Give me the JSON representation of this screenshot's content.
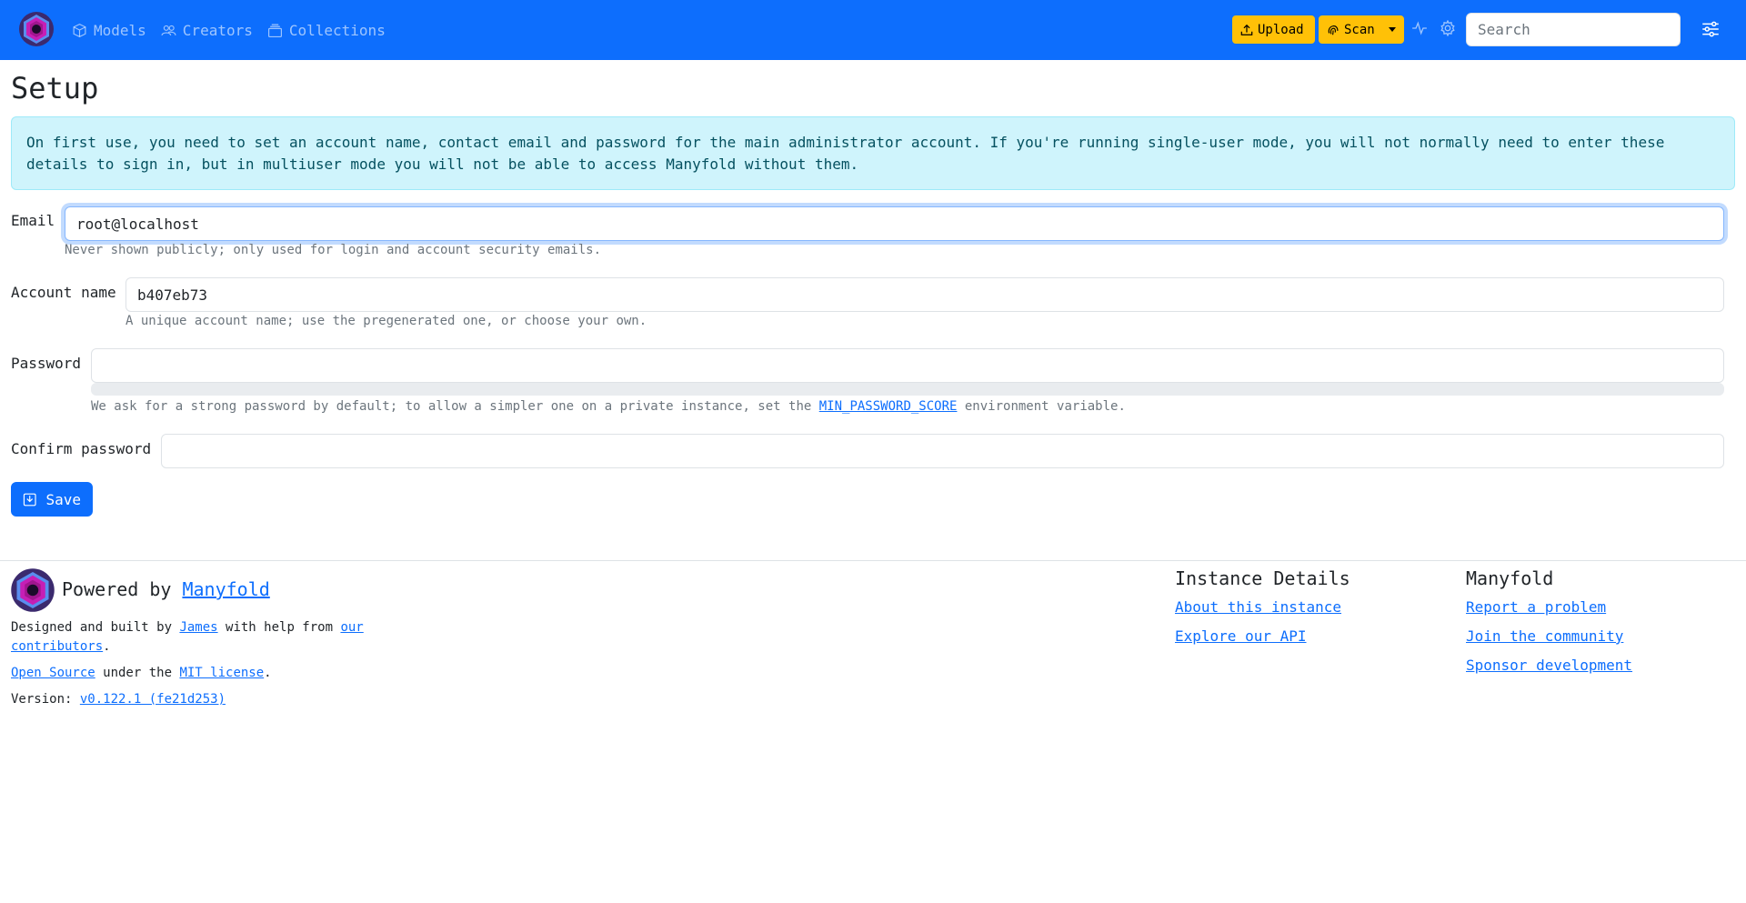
{
  "navbar": {
    "links": [
      {
        "label": "Models",
        "icon": "box-icon"
      },
      {
        "label": "Creators",
        "icon": "people-icon"
      },
      {
        "label": "Collections",
        "icon": "collection-icon"
      }
    ],
    "upload_label": "Upload",
    "scan_label": "Scan",
    "search_placeholder": "Search",
    "colors": {
      "primary": "#0d6efd",
      "warning": "#ffc107"
    }
  },
  "page": {
    "title": "Setup",
    "alert": "On first use, you need to set an account name, contact email and password for the main administrator account. If you're running single-user mode, you will not normally need to enter these details to sign in, but in multiuser mode you will not be able to access Manyfold without them."
  },
  "form": {
    "email": {
      "label": "Email",
      "value": "root@localhost",
      "help": "Never shown publicly; only used for login and account security emails."
    },
    "account_name": {
      "label": "Account name",
      "value": "b407eb73",
      "help": "A unique account name; use the pregenerated one, or choose your own."
    },
    "password": {
      "label": "Password",
      "value": "",
      "strength": 0,
      "help_before": "We ask for a strong password by default; to allow a simpler one on a private instance, set the ",
      "help_link": "MIN_PASSWORD_SCORE",
      "help_after": " environment variable."
    },
    "confirm_password": {
      "label": "Confirm password",
      "value": ""
    },
    "save_label": "Save"
  },
  "footer": {
    "powered_by": "Powered by ",
    "powered_link": "Manyfold",
    "designed_by": "Designed and built by ",
    "designer_link": "James",
    "with_help": " with help from ",
    "our": "our",
    "contributors_link": "contributors",
    "period": ".",
    "open_source_link": "Open Source",
    "under_the": " under the ",
    "mit_link": "MIT license",
    "version_label": "Version: ",
    "version_link": "v0.122.1 (fe21d253)",
    "instance_heading": "Instance Details",
    "instance_links": [
      "About this instance",
      "Explore our API"
    ],
    "manyfold_heading": "Manyfold",
    "manyfold_links": [
      "Report a problem",
      "Join the community",
      "Sponsor development"
    ]
  }
}
